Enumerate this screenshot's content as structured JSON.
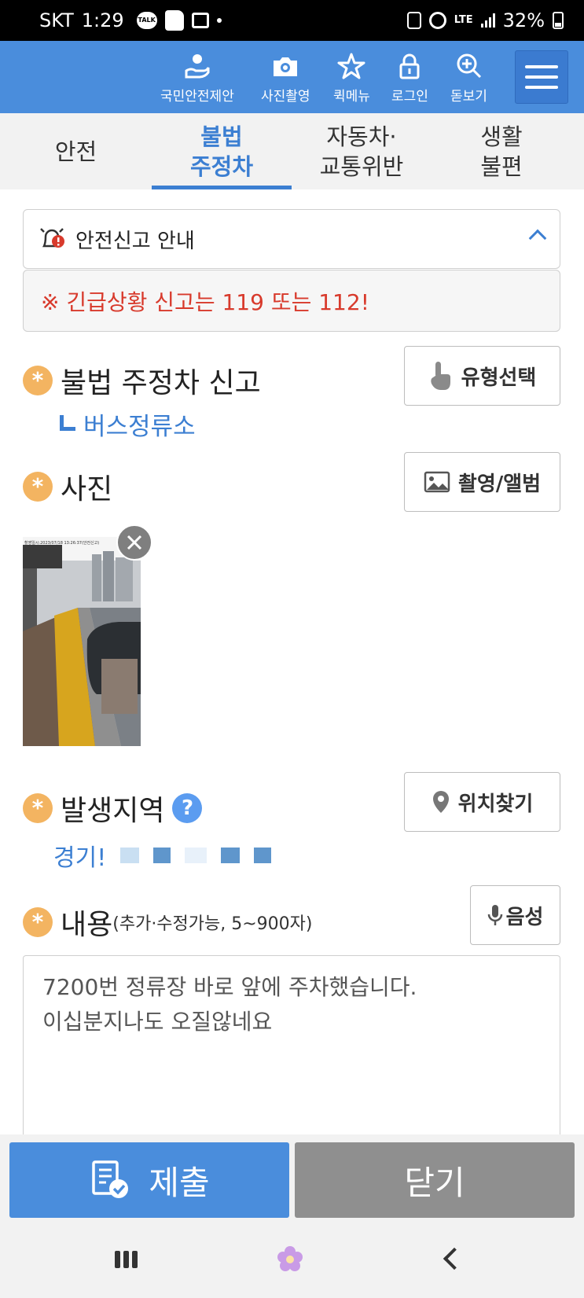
{
  "status_bar": {
    "carrier": "SKT",
    "time": "1:29",
    "talk_badge": "TALK",
    "network": "LTE",
    "battery": "32%"
  },
  "header": {
    "items": [
      {
        "label": "국민안전제안",
        "icon": "hand-heart-icon"
      },
      {
        "label": "사진촬영",
        "icon": "camera-icon"
      },
      {
        "label": "퀵메뉴",
        "icon": "star-icon"
      },
      {
        "label": "로그인",
        "icon": "lock-icon"
      },
      {
        "label": "돋보기",
        "icon": "magnifier-plus-icon"
      }
    ],
    "menu_icon": "hamburger-menu-icon"
  },
  "tabs": [
    {
      "label": "안전",
      "active": false
    },
    {
      "label": "불법\n주정차",
      "active": true
    },
    {
      "label": "자동차·\n교통위반",
      "active": false
    },
    {
      "label": "생활\n불편",
      "active": false
    }
  ],
  "guide": {
    "title": "안전신고 안내",
    "alert": "※ 긴급상황 신고는 119 또는 112!"
  },
  "report": {
    "type_title": "불법 주정차 신고",
    "type_button": "유형선택",
    "selected_type": "버스정류소",
    "photo_title": "사진",
    "photo_button": "촬영/앨범",
    "photo_caption": "촬영일시:2023/07/18 13:26:37(안전신고)",
    "region_title": "발생지역",
    "help_mark": "?",
    "location_button": "위치찾기",
    "region_value": "경기!",
    "content_title": "내용",
    "content_hint": "(추가·수정가능, 5~900자)",
    "voice_button": "음성",
    "content_text": "7200번 정류장 바로 앞에 주차했습니다.\n이십분지나도 오질않네요"
  },
  "actions": {
    "submit": "제출",
    "close": "닫기"
  },
  "colors": {
    "primary": "#4a8ddc",
    "accent_text": "#3c7fd2",
    "alert_red": "#d83a2c",
    "required_star": "#f3b461",
    "close_gray": "#8f8f8f"
  }
}
